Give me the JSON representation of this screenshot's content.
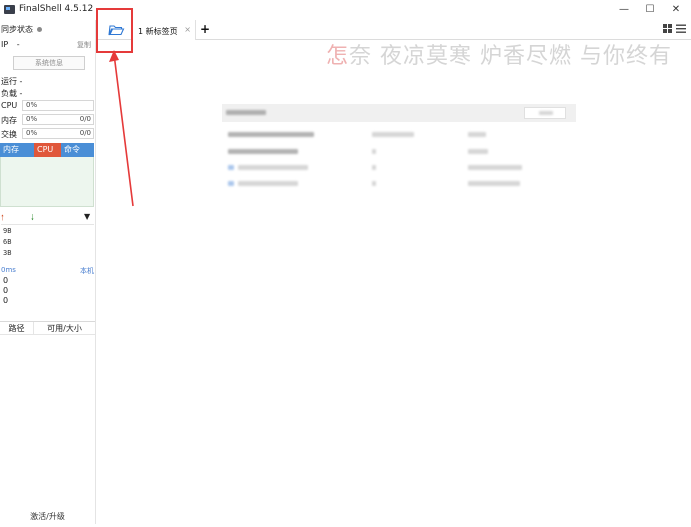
{
  "window": {
    "title": "FinalShell 4.5.12"
  },
  "sidebar": {
    "sync_label": "同步状态",
    "ip_label": "IP",
    "ip_value": "-",
    "copy_label": "复制",
    "sysinfo_button": "系统信息",
    "uptime_label": "运行 -",
    "load_label": "负载 -",
    "meters": [
      {
        "label": "CPU",
        "value": "0%",
        "extra": ""
      },
      {
        "label": "内存",
        "value": "0%",
        "extra": "0/0"
      },
      {
        "label": "交换",
        "value": "0%",
        "extra": "0/0"
      }
    ],
    "process_tabs": [
      "内存",
      "CPU",
      "命令"
    ],
    "process_active": "CPU",
    "net_scale": [
      "9B",
      "6B",
      "3B"
    ],
    "ping": {
      "latency": "0ms",
      "host": "本机",
      "values": [
        "0",
        "0",
        "0"
      ]
    },
    "disk_headers": [
      "路径",
      "可用/大小"
    ],
    "activate_label": "激活/升级"
  },
  "tabs": {
    "items": [
      {
        "label": "1 新标签页",
        "close": "×"
      }
    ],
    "add": "+"
  },
  "watermark": {
    "first_char": "怎",
    "text": "奈 夜凉莫寒 炉香尽燃 与你终有"
  },
  "colors": {
    "accent": "#4a8ed6",
    "active_tab": "#e0573b",
    "annotation": "#e53a3a"
  },
  "icons": {
    "folder": "folder-open-icon",
    "grid": "grid-view-icon",
    "menu": "menu-icon"
  }
}
